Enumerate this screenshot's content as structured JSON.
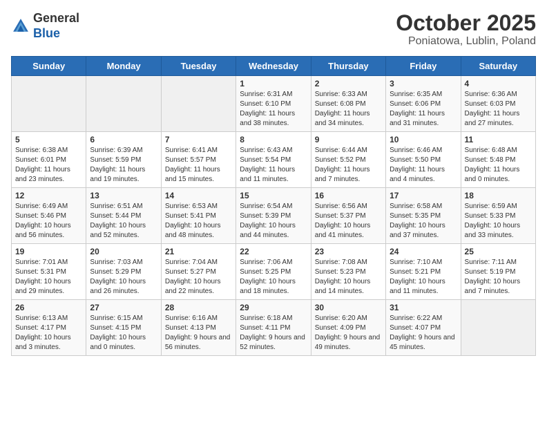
{
  "header": {
    "logo_general": "General",
    "logo_blue": "Blue",
    "month": "October 2025",
    "location": "Poniatowa, Lublin, Poland"
  },
  "weekdays": [
    "Sunday",
    "Monday",
    "Tuesday",
    "Wednesday",
    "Thursday",
    "Friday",
    "Saturday"
  ],
  "weeks": [
    [
      {
        "day": "",
        "info": ""
      },
      {
        "day": "",
        "info": ""
      },
      {
        "day": "",
        "info": ""
      },
      {
        "day": "1",
        "info": "Sunrise: 6:31 AM\nSunset: 6:10 PM\nDaylight: 11 hours\nand 38 minutes."
      },
      {
        "day": "2",
        "info": "Sunrise: 6:33 AM\nSunset: 6:08 PM\nDaylight: 11 hours\nand 34 minutes."
      },
      {
        "day": "3",
        "info": "Sunrise: 6:35 AM\nSunset: 6:06 PM\nDaylight: 11 hours\nand 31 minutes."
      },
      {
        "day": "4",
        "info": "Sunrise: 6:36 AM\nSunset: 6:03 PM\nDaylight: 11 hours\nand 27 minutes."
      }
    ],
    [
      {
        "day": "5",
        "info": "Sunrise: 6:38 AM\nSunset: 6:01 PM\nDaylight: 11 hours\nand 23 minutes."
      },
      {
        "day": "6",
        "info": "Sunrise: 6:39 AM\nSunset: 5:59 PM\nDaylight: 11 hours\nand 19 minutes."
      },
      {
        "day": "7",
        "info": "Sunrise: 6:41 AM\nSunset: 5:57 PM\nDaylight: 11 hours\nand 15 minutes."
      },
      {
        "day": "8",
        "info": "Sunrise: 6:43 AM\nSunset: 5:54 PM\nDaylight: 11 hours\nand 11 minutes."
      },
      {
        "day": "9",
        "info": "Sunrise: 6:44 AM\nSunset: 5:52 PM\nDaylight: 11 hours\nand 7 minutes."
      },
      {
        "day": "10",
        "info": "Sunrise: 6:46 AM\nSunset: 5:50 PM\nDaylight: 11 hours\nand 4 minutes."
      },
      {
        "day": "11",
        "info": "Sunrise: 6:48 AM\nSunset: 5:48 PM\nDaylight: 11 hours\nand 0 minutes."
      }
    ],
    [
      {
        "day": "12",
        "info": "Sunrise: 6:49 AM\nSunset: 5:46 PM\nDaylight: 10 hours\nand 56 minutes."
      },
      {
        "day": "13",
        "info": "Sunrise: 6:51 AM\nSunset: 5:44 PM\nDaylight: 10 hours\nand 52 minutes."
      },
      {
        "day": "14",
        "info": "Sunrise: 6:53 AM\nSunset: 5:41 PM\nDaylight: 10 hours\nand 48 minutes."
      },
      {
        "day": "15",
        "info": "Sunrise: 6:54 AM\nSunset: 5:39 PM\nDaylight: 10 hours\nand 44 minutes."
      },
      {
        "day": "16",
        "info": "Sunrise: 6:56 AM\nSunset: 5:37 PM\nDaylight: 10 hours\nand 41 minutes."
      },
      {
        "day": "17",
        "info": "Sunrise: 6:58 AM\nSunset: 5:35 PM\nDaylight: 10 hours\nand 37 minutes."
      },
      {
        "day": "18",
        "info": "Sunrise: 6:59 AM\nSunset: 5:33 PM\nDaylight: 10 hours\nand 33 minutes."
      }
    ],
    [
      {
        "day": "19",
        "info": "Sunrise: 7:01 AM\nSunset: 5:31 PM\nDaylight: 10 hours\nand 29 minutes."
      },
      {
        "day": "20",
        "info": "Sunrise: 7:03 AM\nSunset: 5:29 PM\nDaylight: 10 hours\nand 26 minutes."
      },
      {
        "day": "21",
        "info": "Sunrise: 7:04 AM\nSunset: 5:27 PM\nDaylight: 10 hours\nand 22 minutes."
      },
      {
        "day": "22",
        "info": "Sunrise: 7:06 AM\nSunset: 5:25 PM\nDaylight: 10 hours\nand 18 minutes."
      },
      {
        "day": "23",
        "info": "Sunrise: 7:08 AM\nSunset: 5:23 PM\nDaylight: 10 hours\nand 14 minutes."
      },
      {
        "day": "24",
        "info": "Sunrise: 7:10 AM\nSunset: 5:21 PM\nDaylight: 10 hours\nand 11 minutes."
      },
      {
        "day": "25",
        "info": "Sunrise: 7:11 AM\nSunset: 5:19 PM\nDaylight: 10 hours\nand 7 minutes."
      }
    ],
    [
      {
        "day": "26",
        "info": "Sunrise: 6:13 AM\nSunset: 4:17 PM\nDaylight: 10 hours\nand 3 minutes."
      },
      {
        "day": "27",
        "info": "Sunrise: 6:15 AM\nSunset: 4:15 PM\nDaylight: 10 hours\nand 0 minutes."
      },
      {
        "day": "28",
        "info": "Sunrise: 6:16 AM\nSunset: 4:13 PM\nDaylight: 9 hours\nand 56 minutes."
      },
      {
        "day": "29",
        "info": "Sunrise: 6:18 AM\nSunset: 4:11 PM\nDaylight: 9 hours\nand 52 minutes."
      },
      {
        "day": "30",
        "info": "Sunrise: 6:20 AM\nSunset: 4:09 PM\nDaylight: 9 hours\nand 49 minutes."
      },
      {
        "day": "31",
        "info": "Sunrise: 6:22 AM\nSunset: 4:07 PM\nDaylight: 9 hours\nand 45 minutes."
      },
      {
        "day": "",
        "info": ""
      }
    ]
  ]
}
